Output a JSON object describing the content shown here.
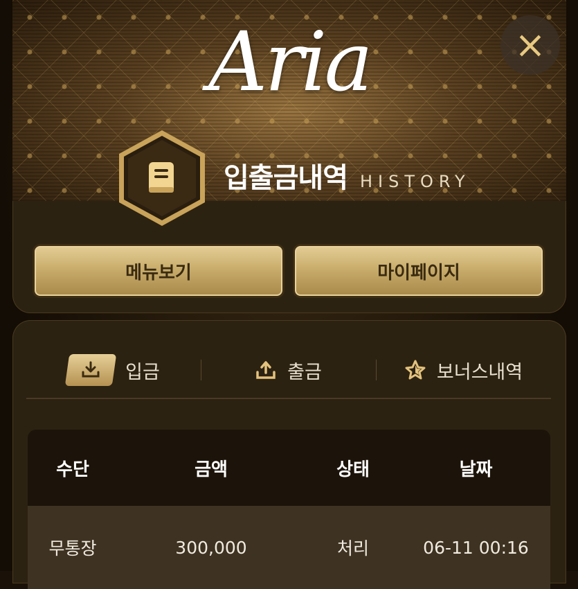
{
  "header": {
    "logo_text": "Aria",
    "title": "입출금내역",
    "subtitle": "HISTORY",
    "close_label": "×"
  },
  "nav_buttons": {
    "menu_label": "메뉴보기",
    "mypage_label": "마이페이지"
  },
  "tabs": [
    {
      "label": "입금",
      "icon": "download-icon",
      "active": true
    },
    {
      "label": "출금",
      "icon": "upload-icon",
      "active": false
    },
    {
      "label": "보너스내역",
      "icon": "star-icon",
      "active": false
    }
  ],
  "table": {
    "headers": [
      "수단",
      "금액",
      "상태",
      "날짜"
    ],
    "rows": [
      {
        "method": "무통장",
        "amount": "300,000",
        "status": "처리",
        "date": "06-11 00:16"
      }
    ]
  },
  "colors": {
    "accent_gold": "#d6b06a",
    "panel_bg": "#2c2212"
  }
}
